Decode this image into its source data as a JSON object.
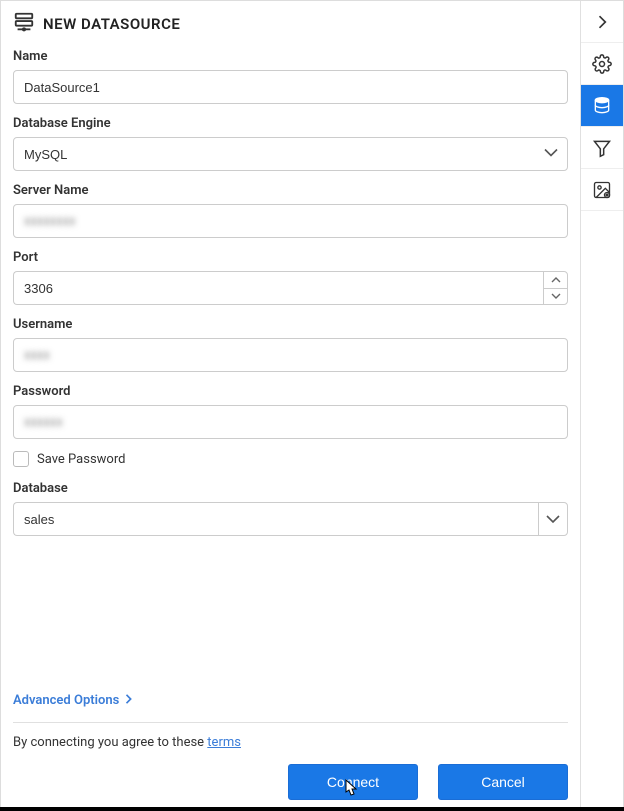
{
  "header": {
    "title": "NEW DATASOURCE"
  },
  "form": {
    "name": {
      "label": "Name",
      "value": "DataSource1"
    },
    "engine": {
      "label": "Database Engine",
      "value": "MySQL"
    },
    "server": {
      "label": "Server Name",
      "value": ""
    },
    "port": {
      "label": "Port",
      "value": "3306"
    },
    "username": {
      "label": "Username",
      "value": ""
    },
    "password": {
      "label": "Password",
      "value": ""
    },
    "savePassword": {
      "label": "Save Password",
      "checked": false
    },
    "database": {
      "label": "Database",
      "value": "sales"
    }
  },
  "advanced": {
    "label": "Advanced Options"
  },
  "agree": {
    "text": "By connecting you agree to these ",
    "link": "terms"
  },
  "buttons": {
    "connect": "Connect",
    "cancel": "Cancel"
  }
}
